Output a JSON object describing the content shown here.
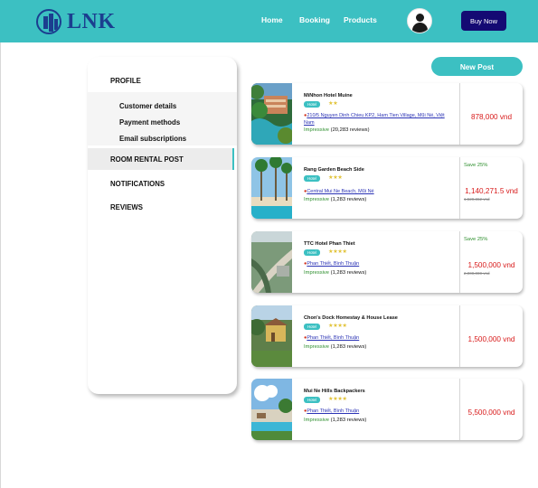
{
  "brand": {
    "name": "LNK"
  },
  "nav": {
    "home": "Home",
    "booking": "Booking",
    "products": "Products",
    "book_now": "Buy Now"
  },
  "sidebar": {
    "profile": "PROFILE",
    "sub_items": [
      "Customer details",
      "Payment methods",
      "Email subscriptions"
    ],
    "room_rental_post": "ROOM RENTAL POST",
    "notifications": "NOTIFICATIONS",
    "reviews": "REVIEWS"
  },
  "actions": {
    "new_post": "New Post"
  },
  "listings": [
    {
      "name": "MiNhon Hotel Muine",
      "tag": "Hotel",
      "stars": "★★",
      "address": "210/5 Nguyen Dinh Chieu KP2, Ham Tien Village, Mũi Né, Việt Nam",
      "rating_label": "Impressive",
      "reviews": "(20,283 reviews)",
      "price": "878,000 vnd",
      "save": "",
      "old_price": ""
    },
    {
      "name": "Rang Garden Beach Side",
      "tag": "Hotel",
      "stars": "★★★",
      "address": "Central Mui Ne Beach, Mũi Né",
      "rating_label": "Impressive",
      "reviews": "(1,283 reviews)",
      "price": "1,140,271.5 vnd",
      "save": "Save 25%",
      "old_price": "1,520,362 vnd"
    },
    {
      "name": "TTC Hotel Phan Thiet",
      "tag": "Hotel",
      "stars": "★★★★",
      "address": "Phan Thiết, Bình Thuận",
      "rating_label": "Impressive",
      "reviews": "(1,283 reviews)",
      "price": "1,500,000 vnd",
      "save": "Save 25%",
      "old_price": "2,000,000 vnd"
    },
    {
      "name": "Chon's Dock Homestay & House Lease",
      "tag": "Hotel",
      "stars": "★★★★",
      "address": "Phan Thiết, Bình Thuận",
      "rating_label": "Impressive",
      "reviews": "(1,283 reviews)",
      "price": "1,500,000 vnd",
      "save": "",
      "old_price": ""
    },
    {
      "name": "Mui Ne Hills Backpackers",
      "tag": "Hotel",
      "stars": "★★★★",
      "address": "Phan Thiết, Bình Thuận",
      "rating_label": "Impressive",
      "reviews": "(1,283 reviews)",
      "price": "5,500,000 vnd",
      "save": "",
      "old_price": ""
    }
  ],
  "icons": {
    "location": "location-pin-icon",
    "avatar": "user-avatar-icon",
    "star": "star-icon"
  },
  "colors": {
    "accent": "#3cc0c2",
    "brand": "#1b3e8f",
    "button_dark": "#140a73",
    "price": "#d81a1a",
    "save": "#2e8f2e",
    "link": "#2b33b5",
    "stars": "#e2c43c"
  }
}
